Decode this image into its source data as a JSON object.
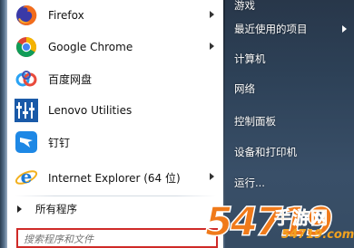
{
  "programs": [
    {
      "label": "Firefox",
      "icon": "firefox-icon",
      "has_submenu": true
    },
    {
      "label": "Google Chrome",
      "icon": "chrome-icon",
      "has_submenu": true
    },
    {
      "label": "百度网盘",
      "icon": "baidu-netdisk-icon",
      "has_submenu": false
    },
    {
      "label": "Lenovo Utilities",
      "icon": "lenovo-utilities-icon",
      "has_submenu": false
    },
    {
      "label": "钉钉",
      "icon": "dingtalk-icon",
      "has_submenu": false
    },
    {
      "label": "Internet Explorer (64 位)",
      "icon": "internet-explorer-icon",
      "has_submenu": true
    }
  ],
  "all_programs_label": "所有程序",
  "search": {
    "placeholder": "搜索程序和文件"
  },
  "right_items": [
    {
      "label": "游戏",
      "has_submenu": false
    },
    {
      "label": "最近使用的项目",
      "has_submenu": true
    },
    {
      "label": "计算机",
      "has_submenu": false
    },
    {
      "label": "网络",
      "has_submenu": false
    },
    {
      "label": "控制面板",
      "has_submenu": false
    },
    {
      "label": "设备和打印机",
      "has_submenu": false
    },
    {
      "label": "运行...",
      "has_submenu": false
    }
  ],
  "watermark": {
    "number": "54719",
    "text": "手游网",
    "url": "54719.com"
  },
  "colors": {
    "search_highlight": "#cf2a27",
    "right_panel": "#2d4157",
    "watermark": "#f07a1a"
  }
}
